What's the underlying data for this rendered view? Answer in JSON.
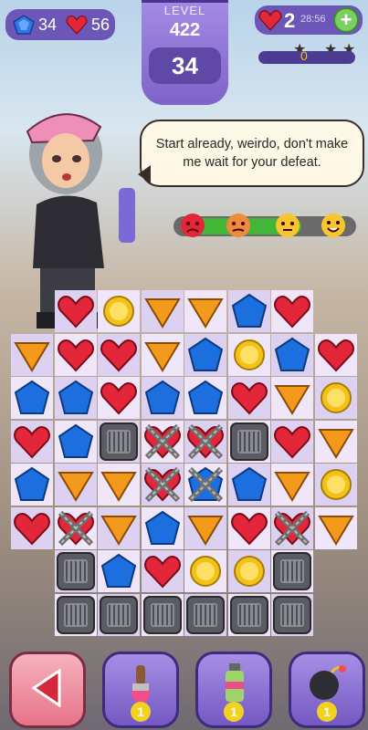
{
  "header": {
    "gems": "34",
    "hearts": "56",
    "level_label": "LEVEL",
    "level": "422",
    "moves": "34",
    "lives": "2",
    "timer": "28:56",
    "progress_score": "0",
    "stars_total": 3
  },
  "dialog": {
    "speech": "Start already, weirdo, don't make me wait for your defeat."
  },
  "mood_meter": {
    "faces": [
      "angry-face-icon",
      "frown-face-icon",
      "neutral-face-icon",
      "happy-face-icon"
    ]
  },
  "board": {
    "rows": [
      [
        "void",
        "heart",
        "coin",
        "triangle",
        "triangle",
        "pentagon",
        "heart",
        "void"
      ],
      [
        "triangle",
        "heart",
        "heart",
        "triangle",
        "pentagon",
        "coin",
        "pentagon",
        "heart"
      ],
      [
        "pentagon",
        "pentagon",
        "heart",
        "pentagon",
        "pentagon",
        "heart",
        "triangle",
        "coin"
      ],
      [
        "heart",
        "pentagon",
        "cage",
        "chain-heart",
        "chain-heart",
        "cage",
        "heart",
        "triangle"
      ],
      [
        "pentagon",
        "triangle",
        "triangle",
        "chain-heart",
        "chain-pentagon",
        "pentagon",
        "triangle",
        "coin"
      ],
      [
        "heart",
        "chain-heart",
        "triangle",
        "pentagon",
        "triangle",
        "heart",
        "chain-heart",
        "triangle"
      ],
      [
        "void",
        "cage",
        "pentagon",
        "heart",
        "coin",
        "coin",
        "cage",
        "void"
      ],
      [
        "void",
        "cage",
        "cage",
        "cage",
        "cage",
        "cage",
        "cage",
        "void"
      ]
    ]
  },
  "boosters": [
    {
      "name": "back-button",
      "count": ""
    },
    {
      "name": "paint-brush",
      "count": "1"
    },
    {
      "name": "spray-can",
      "count": "1"
    },
    {
      "name": "bomb",
      "count": "1"
    }
  ],
  "colors": {
    "purple": "#7a5fc6",
    "heart": "#e3263a",
    "coin": "#f2c21b",
    "triangle": "#f39a1d",
    "pentagon": "#1d6fe0"
  }
}
